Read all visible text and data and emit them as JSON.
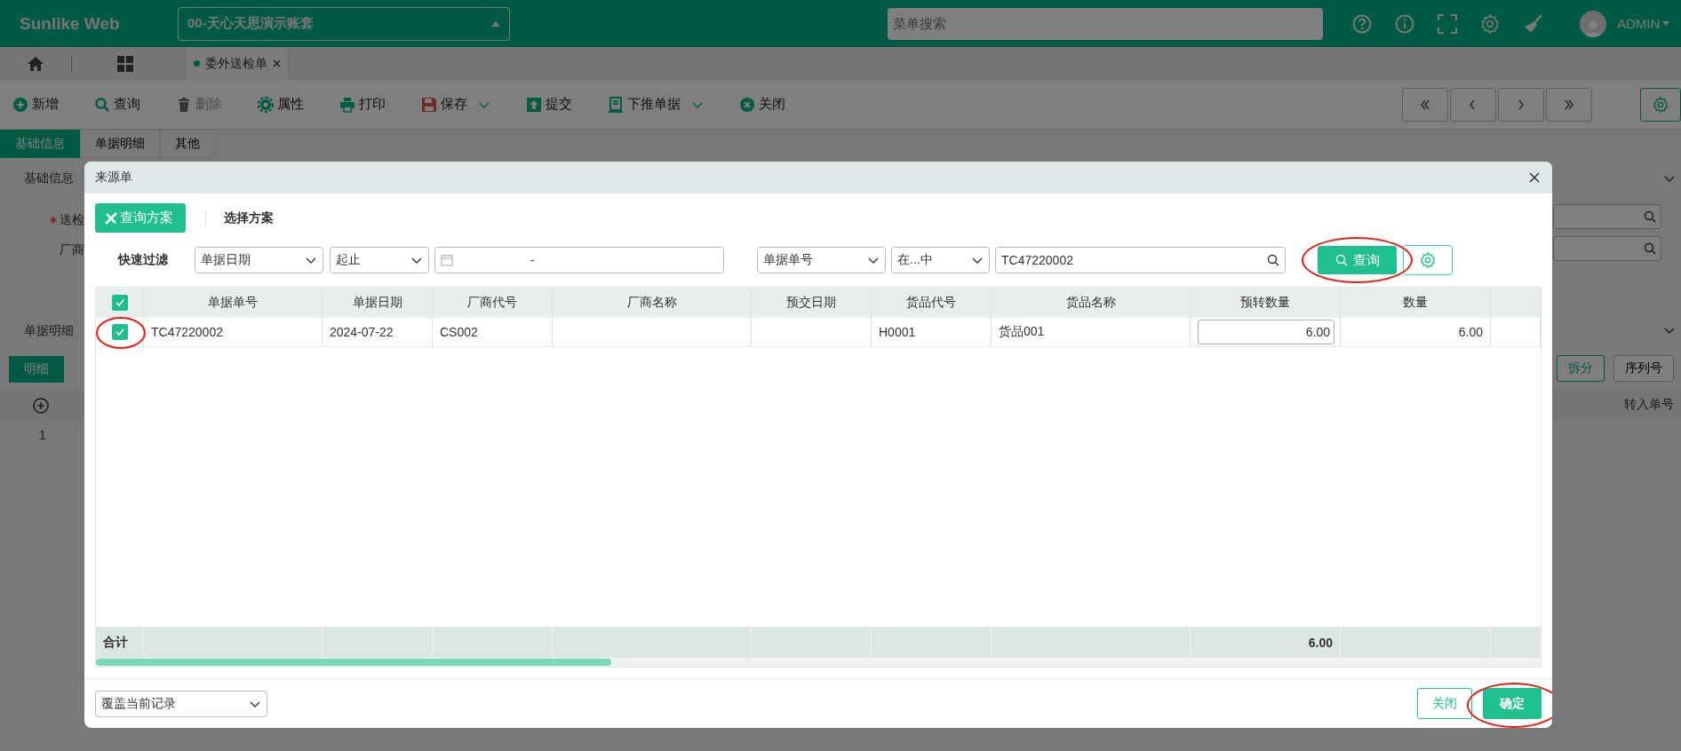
{
  "header": {
    "logo": "Sunlike Web",
    "account": "00-天心天思演示账套",
    "search": {
      "placeholder": "菜单搜索"
    },
    "user": "ADMIN"
  },
  "tabs": [
    {
      "label": "委外送检单",
      "selected": true
    }
  ],
  "toolbar": [
    {
      "label": "新增",
      "disabled": false,
      "dropdown": false
    },
    {
      "label": "查询",
      "disabled": false,
      "dropdown": false
    },
    {
      "label": "删除",
      "disabled": true,
      "dropdown": false
    },
    {
      "label": "属性",
      "disabled": false,
      "dropdown": false
    },
    {
      "label": "打印",
      "disabled": false,
      "dropdown": false
    },
    {
      "label": "保存",
      "disabled": false,
      "dropdown": true
    },
    {
      "label": "提交",
      "disabled": false,
      "dropdown": false
    },
    {
      "label": "下推单据",
      "disabled": false,
      "dropdown": true
    },
    {
      "label": "关闭",
      "disabled": false,
      "dropdown": false
    }
  ],
  "form_tabs": [
    {
      "label": "基础信息",
      "selected": true
    },
    {
      "label": "单据明细",
      "selected": false
    },
    {
      "label": "其他",
      "selected": false
    }
  ],
  "background": {
    "section_1": "基础信息",
    "fields": [
      {
        "label": "送检",
        "required": true
      },
      {
        "label": "厂商",
        "required": false
      }
    ],
    "section_2": "单据明细",
    "detail_tab": {
      "label": "明细",
      "selected": true
    },
    "buttons": [
      "拆分",
      "序列号"
    ],
    "row_number": "1",
    "column": "转入单号"
  },
  "dialog": {
    "title": "来源单",
    "scheme_button": "查询方案",
    "scheme_link": "选择方案",
    "filter_label": "快速过滤",
    "filters": [
      {
        "kind": "select",
        "value": "单据日期"
      },
      {
        "kind": "select",
        "value": "起止"
      },
      {
        "kind": "date",
        "value": "-"
      },
      {
        "kind": "select",
        "value": "单据单号"
      },
      {
        "kind": "select",
        "value": "在...中"
      },
      {
        "kind": "search",
        "value": "TC47220002"
      }
    ],
    "query_button": {
      "label": "查询",
      "circled": true
    },
    "table": {
      "all_checked": true,
      "columns": [
        "单据单号",
        "单据日期",
        "厂商代号",
        "厂商名称",
        "预交日期",
        "货品代号",
        "货品名称",
        "预转数量",
        "数量"
      ],
      "rows": [
        {
          "checked": true,
          "circled": true,
          "doc_no": "TC47220002",
          "doc_date": "2024-07-22",
          "vendor_code": "CS002",
          "item_code": "H0001",
          "item_name": "货品001",
          "pre_qty": "6.00",
          "qty": "6.00"
        }
      ],
      "total_label": "合计",
      "pre_qty_total": "6.00"
    },
    "mode_select": "覆盖当前记录",
    "close_button": "关闭",
    "confirm_button": {
      "label": "确定",
      "circled": true
    }
  }
}
